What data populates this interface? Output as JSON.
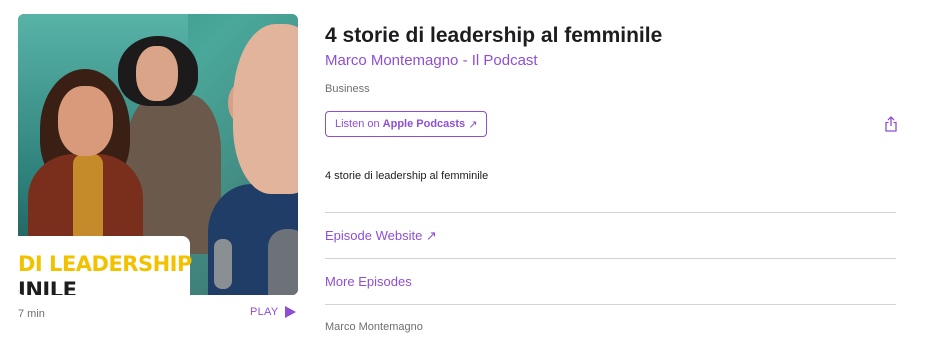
{
  "artwork": {
    "line1": "DI LEADERSHIP",
    "line2": "INILE"
  },
  "episode": {
    "title": "4 storie di leadership al femminile",
    "show": "Marco Montemagno - Il Podcast",
    "category": "Business",
    "duration": "7 min",
    "description": "4 storie di leadership al femminile",
    "author": "Marco Montemagno"
  },
  "actions": {
    "play_label": "PLAY",
    "listen_prefix": "Listen on",
    "listen_brand": "Apple Podcasts",
    "listen_arrow": "↗",
    "share_icon": "share-icon",
    "episode_website": "Episode Website ↗",
    "more_episodes": "More Episodes"
  },
  "colors": {
    "accent": "#8e4fd4",
    "divider": "#d2d2d7",
    "muted_text": "#6e6e73"
  }
}
